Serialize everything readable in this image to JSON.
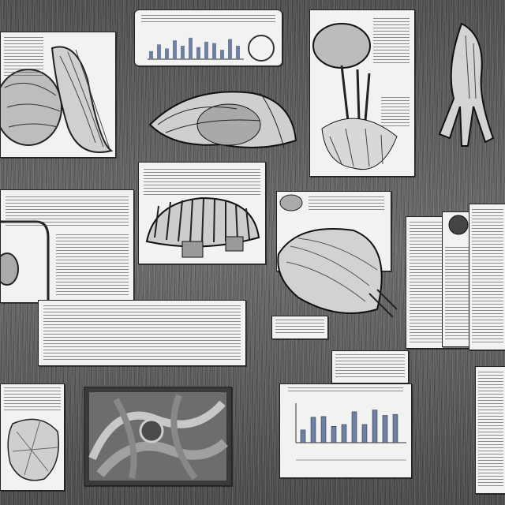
{
  "scene": {
    "description_free": true,
    "colors": {
      "background": "#5a5a5a",
      "paper": "#f2f2f0",
      "ink": "#222222",
      "bar_fill": "#6e7fa8"
    },
    "items": [
      {
        "kind": "text-sheet"
      },
      {
        "kind": "illustration-sheet"
      },
      {
        "kind": "mini-chart"
      },
      {
        "kind": "anatomy-plate"
      },
      {
        "kind": "bar-chart"
      }
    ]
  },
  "bar_chart": {
    "values": [
      0.35,
      0.7,
      0.72,
      0.45,
      0.5,
      0.85,
      0.5,
      0.9,
      0.75,
      0.78
    ]
  },
  "mini_chart": {
    "values": [
      0.3,
      0.55,
      0.4,
      0.7,
      0.5,
      0.8,
      0.45,
      0.65,
      0.6,
      0.35,
      0.75,
      0.5
    ]
  }
}
